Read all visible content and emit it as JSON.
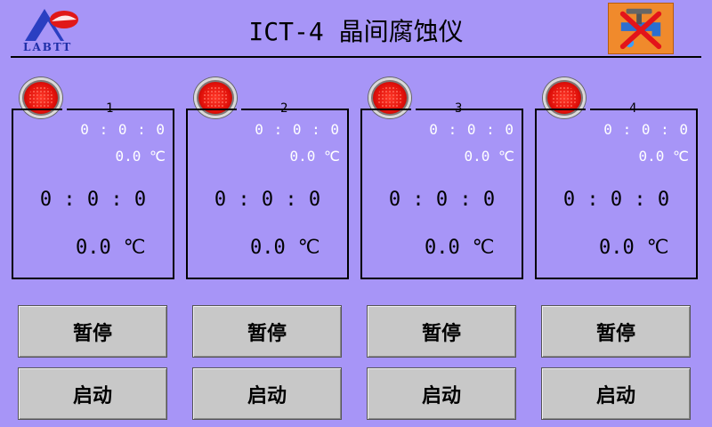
{
  "header": {
    "logo_text": "LABTT",
    "title": "ICT-4 晶间腐蚀仪",
    "valve_icon": "valve-closed-icon"
  },
  "channels": [
    {
      "num": "1",
      "small_time": "0 : 0 : 0",
      "small_temp": "0.0 ℃",
      "big_time": "0 : 0 : 0",
      "big_temp_value": "0.0",
      "big_temp_unit": "℃",
      "pause_label": "暂停",
      "start_label": "启动"
    },
    {
      "num": "2",
      "small_time": "0 : 0 : 0",
      "small_temp": "0.0 ℃",
      "big_time": "0 : 0 : 0",
      "big_temp_value": "0.0",
      "big_temp_unit": "℃",
      "pause_label": "暂停",
      "start_label": "启动"
    },
    {
      "num": "3",
      "small_time": "0 : 0 : 0",
      "small_temp": "0.0 ℃",
      "big_time": "0 : 0 : 0",
      "big_temp_value": "0.0",
      "big_temp_unit": "℃",
      "pause_label": "暂停",
      "start_label": "启动"
    },
    {
      "num": "4",
      "small_time": "0 : 0 : 0",
      "small_temp": "0.0 ℃",
      "big_time": "0 : 0 : 0",
      "big_temp_value": "0.0",
      "big_temp_unit": "℃",
      "pause_label": "暂停",
      "start_label": "启动"
    }
  ],
  "colors": {
    "background": "#a795f7",
    "lamp_red": "#e0100a",
    "button_gray": "#c8c8c8",
    "valve_bg": "#f08a2c"
  }
}
